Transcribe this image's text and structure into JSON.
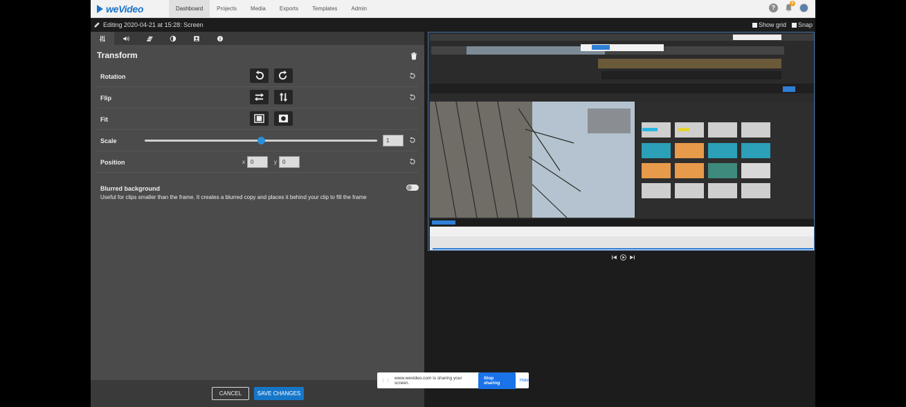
{
  "nav": {
    "logo": "weVideo",
    "items": [
      "Dashboard",
      "Projects",
      "Media",
      "Exports",
      "Templates",
      "Admin"
    ],
    "notifications_count": "8"
  },
  "editbar": {
    "title": "Editing 2020-04-21 at 15:28: Screen",
    "show_grid": "Show grid",
    "snap": "Snap"
  },
  "panel": {
    "tabs": [
      "sliders-icon",
      "volume-icon",
      "layers-icon",
      "contrast-icon",
      "portrait-icon",
      "info-icon"
    ],
    "title": "Transform",
    "rows": {
      "rotation": "Rotation",
      "flip": "Flip",
      "fit": "Fit",
      "scale": "Scale",
      "position": "Position"
    },
    "scale_value": "1",
    "scale_slider_fraction": 0.5,
    "position": {
      "x_label": "x",
      "x_value": "0",
      "y_label": "y",
      "y_value": "0"
    },
    "blurred_background": {
      "title": "Blurred background",
      "description": "Useful for clips smaller than the frame. It creates a blurred copy and places it behind your clip to fill the frame",
      "enabled": false
    }
  },
  "footer": {
    "cancel": "CANCEL",
    "save": "SAVE CHANGES"
  },
  "share_banner": {
    "message": "www.wevideo.com is sharing your screen.",
    "stop": "Stop sharing",
    "hide": "Hide"
  },
  "colors": {
    "accent": "#1677c9",
    "panel_bg": "#4b4b4b",
    "toolbar_bg": "#3a3a3a"
  }
}
